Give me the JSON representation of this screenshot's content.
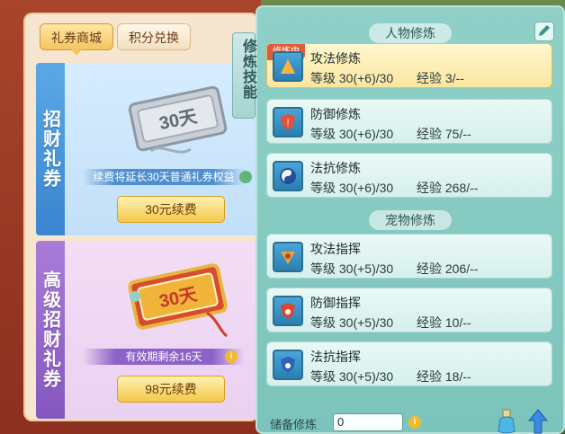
{
  "shop": {
    "tabs": [
      {
        "label": "礼券商城",
        "active": true
      },
      {
        "label": "积分兑换",
        "active": false
      }
    ],
    "coupons": [
      {
        "side_label": "招财礼券",
        "ticket_text": "30天",
        "note": "续费将延长30天普通礼券权益",
        "button": "30元续费"
      },
      {
        "side_label": "高级招财礼券",
        "ticket_text": "30天",
        "note": "有效期剩余16天",
        "button": "98元续费"
      }
    ]
  },
  "cultivation": {
    "side_label": "修炼技能",
    "human_title": "人物修炼",
    "pet_title": "宠物修炼",
    "in_progress_badge": "修炼中",
    "human_skills": [
      {
        "name": "攻法修炼",
        "level": "等级  30(+6)/30",
        "exp": "经验  3/--",
        "icon": "attack-spell-icon",
        "selected": true
      },
      {
        "name": "防御修炼",
        "level": "等级  30(+6)/30",
        "exp": "经验  75/--",
        "icon": "defense-icon",
        "selected": false
      },
      {
        "name": "法抗修炼",
        "level": "等级  30(+6)/30",
        "exp": "经验  268/--",
        "icon": "spell-resist-icon",
        "selected": false
      }
    ],
    "pet_skills": [
      {
        "name": "攻法指挥",
        "level": "等级  30(+5)/30",
        "exp": "经验  206/--",
        "icon": "pet-attack-icon"
      },
      {
        "name": "防御指挥",
        "level": "等级  30(+5)/30",
        "exp": "经验  10/--",
        "icon": "pet-defense-icon"
      },
      {
        "name": "法抗指挥",
        "level": "等级  30(+5)/30",
        "exp": "经验  18/--",
        "icon": "pet-resist-icon"
      }
    ],
    "reserve": {
      "label": "储备修炼",
      "value": "0"
    }
  },
  "colors": {
    "accent_gold": "#f3c94a",
    "panel_teal": "#8fd0c8",
    "basic_blue": "#3a85cf",
    "premium_purple": "#8457c0"
  }
}
